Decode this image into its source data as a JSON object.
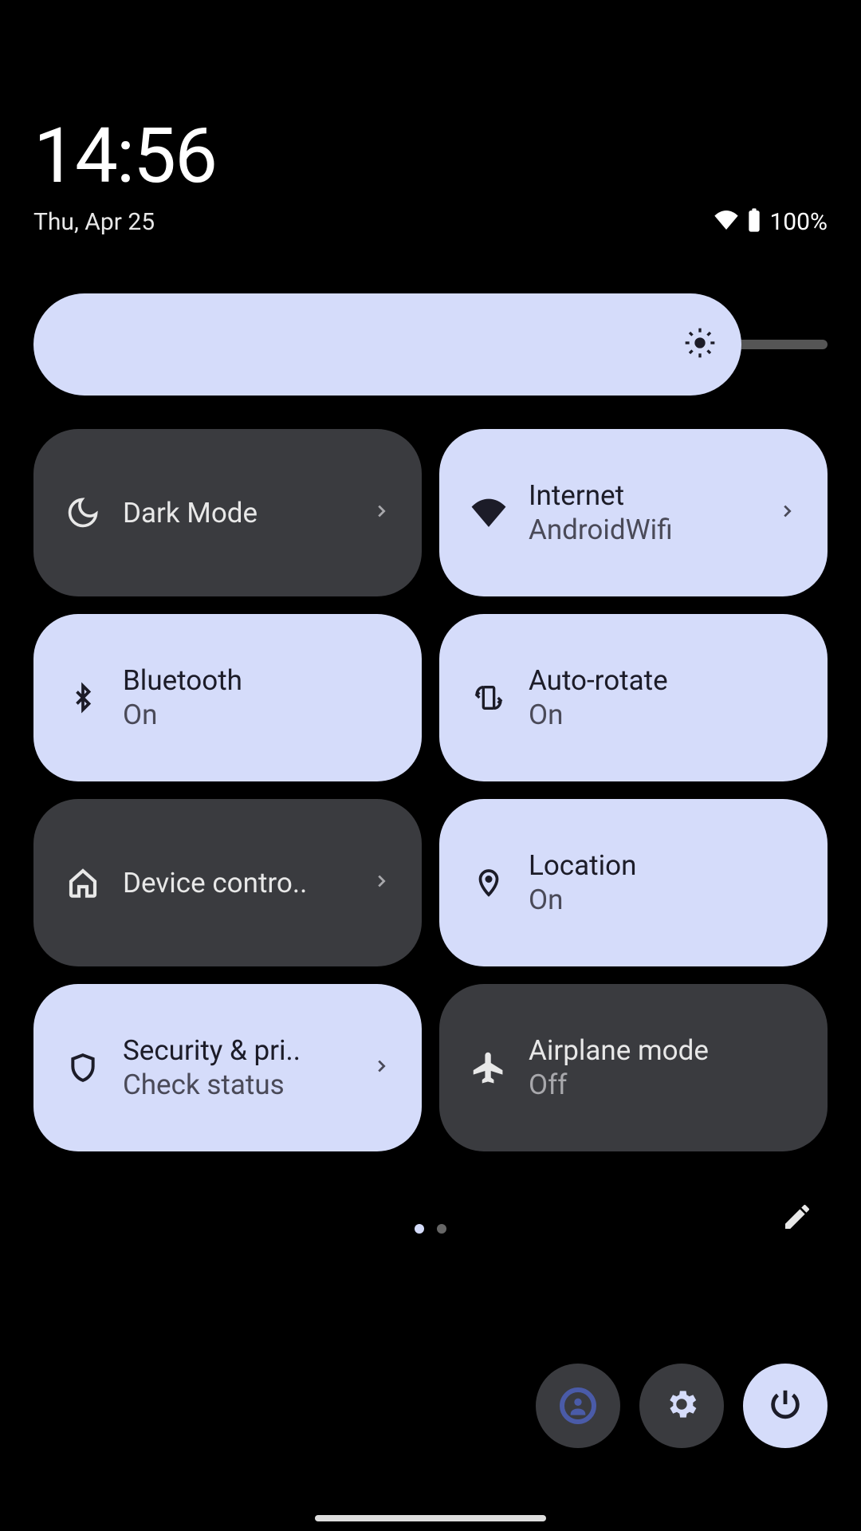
{
  "header": {
    "time": "14:56",
    "date": "Thu, Apr 25",
    "battery": "100%"
  },
  "brightness": {
    "percent": 90
  },
  "tiles": [
    {
      "title": "Dark Mode",
      "subtitle": "",
      "state": "off",
      "chevron": true,
      "icon": "moon-icon"
    },
    {
      "title": "Internet",
      "subtitle": "AndroidWifi",
      "state": "on",
      "chevron": true,
      "icon": "wifi-icon"
    },
    {
      "title": "Bluetooth",
      "subtitle": "On",
      "state": "on",
      "chevron": false,
      "icon": "bluetooth-icon"
    },
    {
      "title": "Auto-rotate",
      "subtitle": "On",
      "state": "on",
      "chevron": false,
      "icon": "rotate-icon"
    },
    {
      "title": "Device contro..",
      "subtitle": "",
      "state": "off",
      "chevron": true,
      "icon": "home-icon"
    },
    {
      "title": "Location",
      "subtitle": "On",
      "state": "on",
      "chevron": false,
      "icon": "location-icon"
    },
    {
      "title": "Security & pri..",
      "subtitle": "Check status",
      "state": "on",
      "chevron": true,
      "icon": "shield-icon"
    },
    {
      "title": "Airplane mode",
      "subtitle": "Off",
      "state": "off",
      "chevron": false,
      "icon": "airplane-icon"
    }
  ],
  "pager": {
    "current": 0,
    "total": 2
  },
  "icons": {
    "wifi_status": "wifi-icon",
    "battery_status": "battery-icon",
    "brightness": "brightness-icon",
    "edit": "pencil-icon",
    "user": "user-icon",
    "settings": "gear-icon",
    "power": "power-icon"
  }
}
